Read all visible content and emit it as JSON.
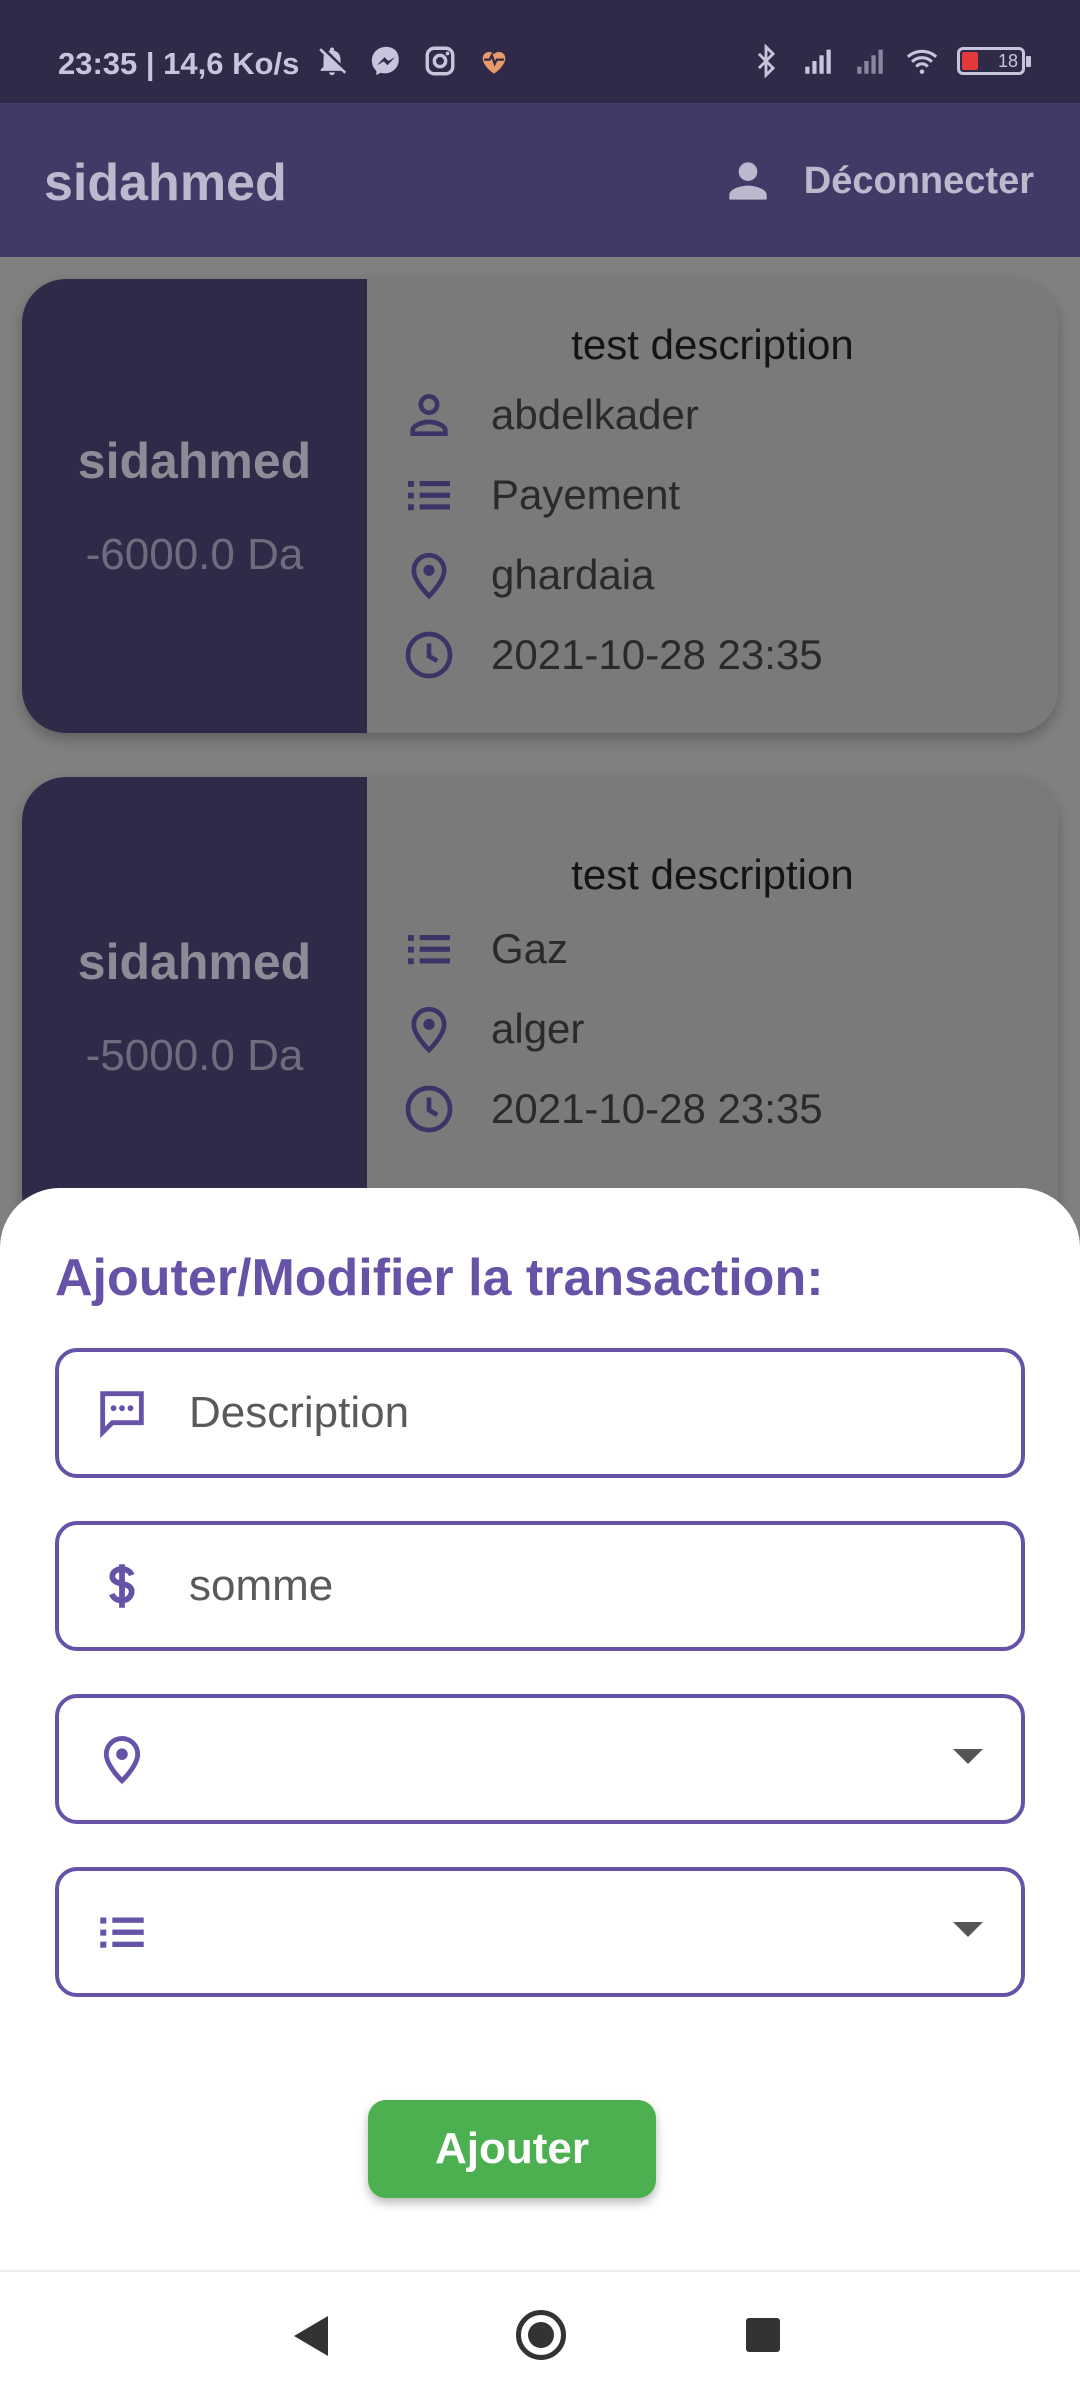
{
  "status_bar": {
    "text": "23:35 | 14,6 Ko/s",
    "battery": "18"
  },
  "app_bar": {
    "title": "sidahmed",
    "logout_label": "Déconnecter"
  },
  "transactions": [
    {
      "name": "sidahmed",
      "amount": "-6000.0 Da",
      "description": "test description",
      "person": "abdelkader",
      "category": "Payement",
      "location": "ghardaia",
      "datetime": "2021-10-28 23:35"
    },
    {
      "name": "sidahmed",
      "amount": "-5000.0 Da",
      "description": "test description",
      "category": "Gaz",
      "location": "alger",
      "datetime": "2021-10-28 23:35"
    }
  ],
  "sheet": {
    "title": "Ajouter/Modifier la transaction:",
    "description_placeholder": "Description",
    "amount_placeholder": "somme",
    "location_value": "",
    "category_value": "",
    "submit_label": "Ajouter"
  },
  "colors": {
    "primary": "#6653a8",
    "app_bar": "#423a66",
    "button": "#4caf50"
  }
}
